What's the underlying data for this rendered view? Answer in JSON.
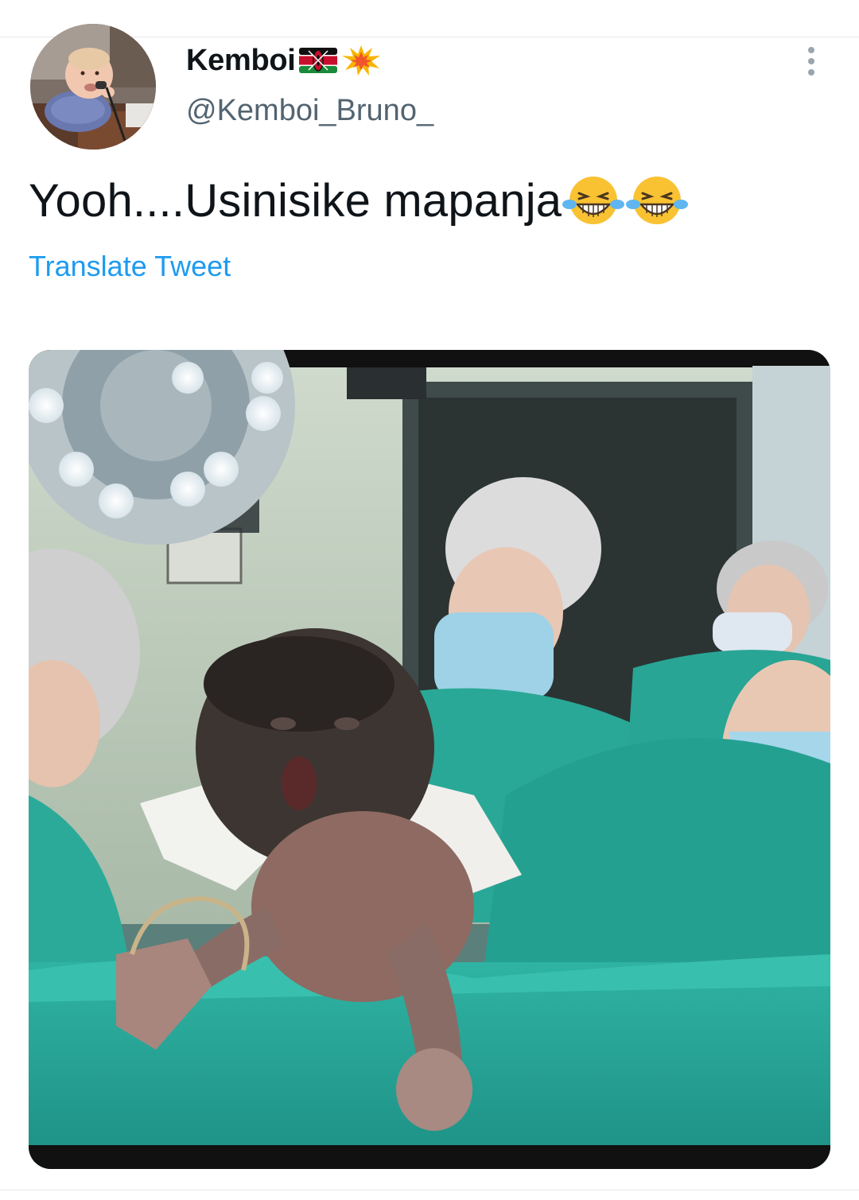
{
  "tweet": {
    "display_name": "Kemboi",
    "name_emojis": [
      "kenya-flag-icon",
      "collision-icon"
    ],
    "handle": "@Kemboi_Bruno_",
    "text": "Yooh....Usinisike mapanja",
    "text_emojis": [
      "grinning-squinting-face-with-tears-icon",
      "grinning-squinting-face-with-tears-icon"
    ],
    "translate_label": "Translate Tweet"
  },
  "colors": {
    "link": "#1d9bf0",
    "primary_text": "#0f1419",
    "secondary_text": "#536471",
    "scrub_green": "#2fb3a3"
  }
}
